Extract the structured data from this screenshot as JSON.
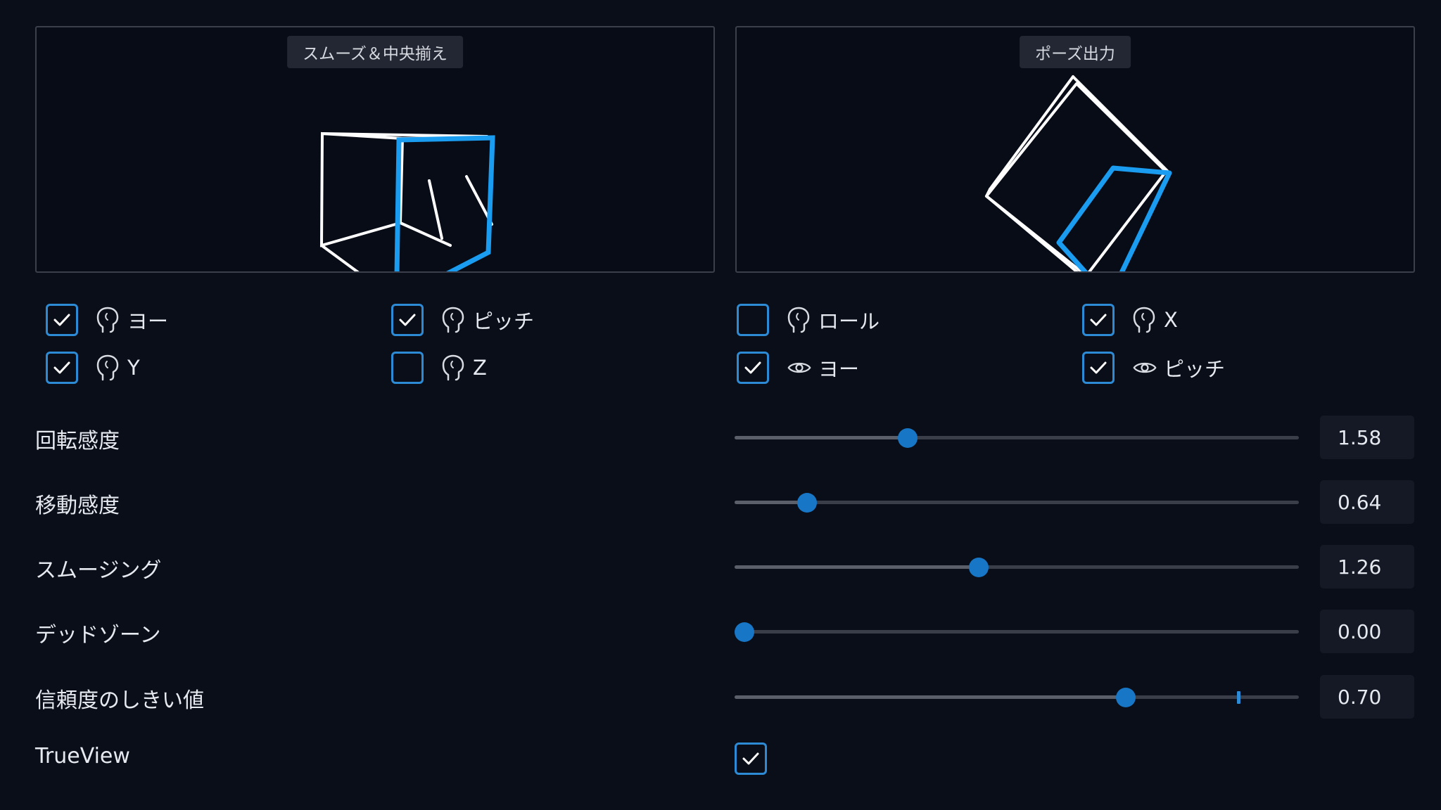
{
  "panels": {
    "left_title": "スムーズ＆中央揃え",
    "right_title": "ポーズ出力"
  },
  "colors": {
    "accent": "#1a9cf0",
    "checkbox_border": "#2d8bd6",
    "slider_thumb": "#1776c6",
    "background": "#0a0e18"
  },
  "checkboxes": [
    {
      "label": "ヨー",
      "icon": "head-icon",
      "checked": true
    },
    {
      "label": "ピッチ",
      "icon": "head-icon",
      "checked": true
    },
    {
      "label": "ロール",
      "icon": "head-icon",
      "checked": false
    },
    {
      "label": "X",
      "icon": "head-icon",
      "checked": true
    },
    {
      "label": "Y",
      "icon": "head-icon",
      "checked": true
    },
    {
      "label": "Z",
      "icon": "head-icon",
      "checked": false
    },
    {
      "label": "ヨー",
      "icon": "eye-icon",
      "checked": true
    },
    {
      "label": "ピッチ",
      "icon": "eye-icon",
      "checked": true
    }
  ],
  "sliders": [
    {
      "label": "回転感度",
      "value": "1.58",
      "fraction": 0.3
    },
    {
      "label": "移動感度",
      "value": "0.64",
      "fraction": 0.115
    },
    {
      "label": "スムージング",
      "value": "1.26",
      "fraction": 0.43
    },
    {
      "label": "デッドゾーン",
      "value": "0.00",
      "fraction": 0.0
    },
    {
      "label": "信頼度のしきい値",
      "value": "0.70",
      "fraction": 0.7,
      "marker_fraction": 0.89
    }
  ],
  "trueview": {
    "label": "TrueView",
    "checked": true
  }
}
